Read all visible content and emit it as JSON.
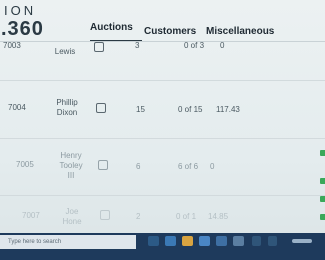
{
  "app": {
    "logo_top": "ION",
    "logo_bottom": ".360"
  },
  "tabs": [
    {
      "label": "Auctions",
      "active": true
    },
    {
      "label": "Customers",
      "active": false
    },
    {
      "label": "Miscellaneous",
      "active": false
    }
  ],
  "rows": [
    {
      "id": "7003",
      "name": "Lewis",
      "count": "3",
      "ratio": "0 of 3",
      "amount": "0"
    },
    {
      "id": "7004",
      "name": "Phillip Dixon",
      "count": "15",
      "ratio": "0 of 15",
      "amount": "117.43"
    },
    {
      "id": "7005",
      "name": "Henry Tooley III",
      "count": "6",
      "ratio": "6 of 6",
      "amount": "0"
    },
    {
      "id": "7007",
      "name": "Joe Hone",
      "count": "2",
      "ratio": "0 of 1",
      "amount": "14.85"
    }
  ],
  "taskbar": {
    "search_placeholder": "Type here to search"
  },
  "colors": {
    "taskbar": "#1e3a5c",
    "accent": "#3aa85a"
  }
}
